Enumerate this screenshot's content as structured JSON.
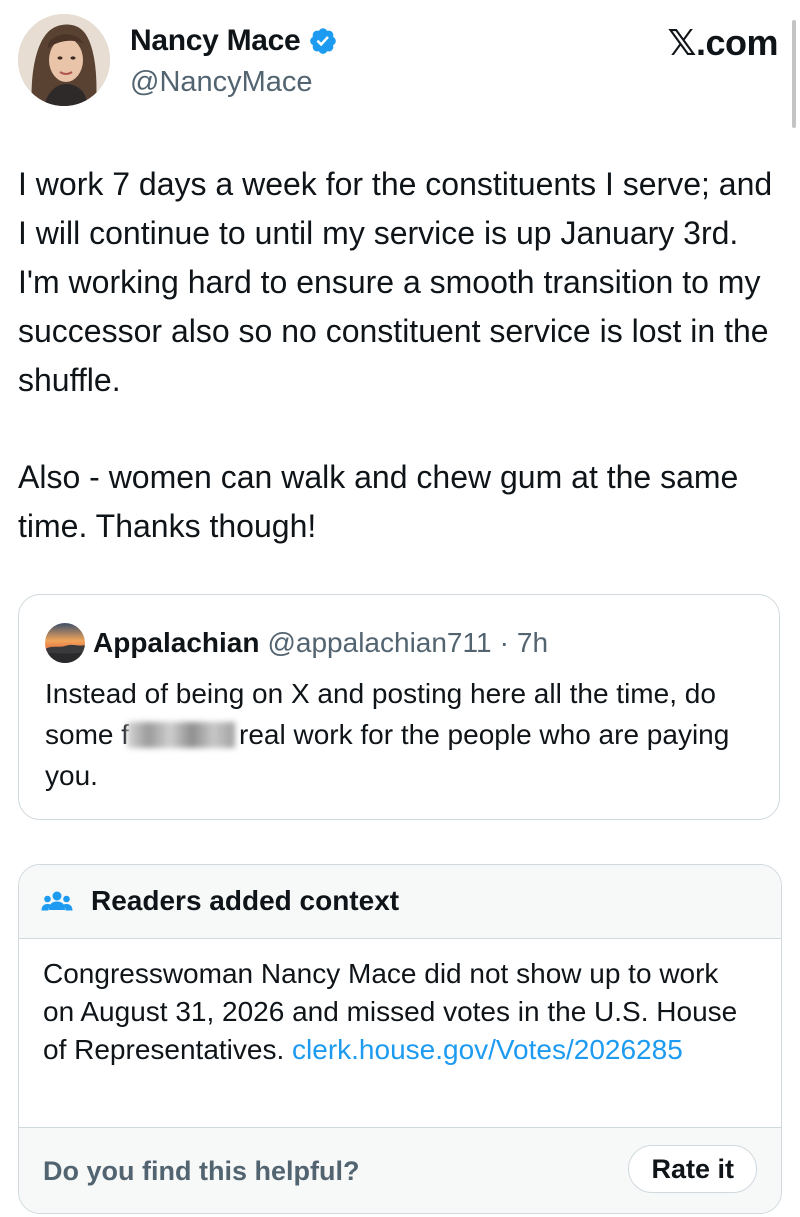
{
  "author": {
    "display_name": "Nancy Mace",
    "handle": "@NancyMace",
    "verified": true,
    "avatar_icon": "profile-photo"
  },
  "brand": {
    "label": "𝕏.com"
  },
  "tweet": {
    "paragraphs": [
      "I work 7 days a week for the constituents I serve; and I will continue to until my service is up January 3rd. I'm working hard to ensure a smooth transition to my successor also so no constituent service is lost in the shuffle.",
      "Also - women can walk and chew gum at the same time. Thanks though!"
    ]
  },
  "quoted_tweet": {
    "display_name": "Appalachian",
    "handle": "@appalachian711",
    "separator": "·",
    "time": "7h",
    "avatar_icon": "sunset-landscape",
    "text_before_redaction": "Instead of being on X and posting here all the time, do some f",
    "text_after_redaction": "real work for the people who are paying you."
  },
  "community_note": {
    "title": "Readers added context",
    "icon": "people-icon",
    "body": "Congresswoman Nancy Mace did not show up to work on August 31, 2026 and missed votes in the U.S. House of Representatives. ",
    "link_text": "clerk.house.gov/​Votes/2026285",
    "footer_question": "Do you find this helpful?",
    "rate_button_label": "Rate it"
  },
  "colors": {
    "text": "#0f1419",
    "secondary_text": "#536471",
    "link": "#1d9bf0",
    "verified_badge": "#1d9bf0",
    "border": "#cfd9de",
    "note_background": "#f7f9f9"
  }
}
